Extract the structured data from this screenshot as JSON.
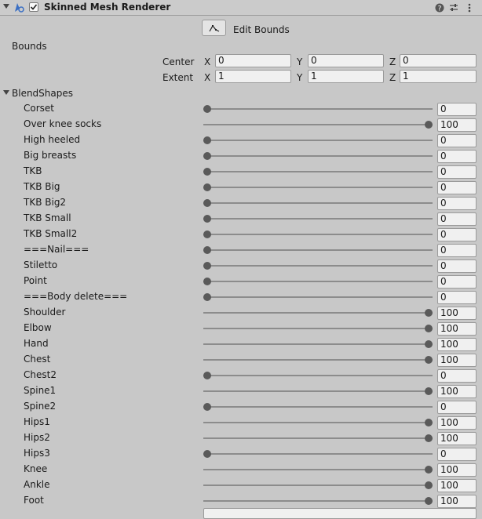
{
  "component": {
    "title": "Skinned Mesh Renderer",
    "enabled": true,
    "icons": [
      "help-icon",
      "presets-icon",
      "menu-icon"
    ]
  },
  "edit_bounds": {
    "label": "Edit Bounds",
    "icon": "edit-bounds-icon"
  },
  "bounds": {
    "label": "Bounds",
    "center": {
      "label": "Center",
      "x_label": "X",
      "y_label": "Y",
      "z_label": "Z",
      "x": "0",
      "y": "0",
      "z": "0"
    },
    "extent": {
      "label": "Extent",
      "x_label": "X",
      "y_label": "Y",
      "z_label": "Z",
      "x": "1",
      "y": "1",
      "z": "1"
    }
  },
  "blendshapes": {
    "label": "BlendShapes",
    "expanded": true,
    "items": [
      {
        "name": "Corset",
        "value": "0"
      },
      {
        "name": "Over knee socks",
        "value": "100"
      },
      {
        "name": "High heeled",
        "value": "0"
      },
      {
        "name": "Big breasts",
        "value": "0"
      },
      {
        "name": "TKB",
        "value": "0"
      },
      {
        "name": "TKB Big",
        "value": "0"
      },
      {
        "name": "TKB Big2",
        "value": "0"
      },
      {
        "name": "TKB Small",
        "value": "0"
      },
      {
        "name": "TKB Small2",
        "value": "0"
      },
      {
        "name": "===Nail===",
        "value": "0"
      },
      {
        "name": "Stiletto",
        "value": "0"
      },
      {
        "name": "Point",
        "value": "0"
      },
      {
        "name": "===Body delete===",
        "value": "0"
      },
      {
        "name": "Shoulder",
        "value": "100"
      },
      {
        "name": "Elbow",
        "value": "100"
      },
      {
        "name": "Hand",
        "value": "100"
      },
      {
        "name": "Chest",
        "value": "100"
      },
      {
        "name": "Chest2",
        "value": "0"
      },
      {
        "name": "Spine1",
        "value": "100"
      },
      {
        "name": "Spine2",
        "value": "0"
      },
      {
        "name": "Hips1",
        "value": "100"
      },
      {
        "name": "Hips2",
        "value": "100"
      },
      {
        "name": "Hips3",
        "value": "0"
      },
      {
        "name": "Knee",
        "value": "100"
      },
      {
        "name": "Ankle",
        "value": "100"
      },
      {
        "name": "Foot",
        "value": "100"
      }
    ]
  },
  "colors": {
    "background": "#c8c8c8",
    "field": "#f0f0f0",
    "thumb": "#5a5a5a",
    "component_icon": "#3a6fc4"
  }
}
